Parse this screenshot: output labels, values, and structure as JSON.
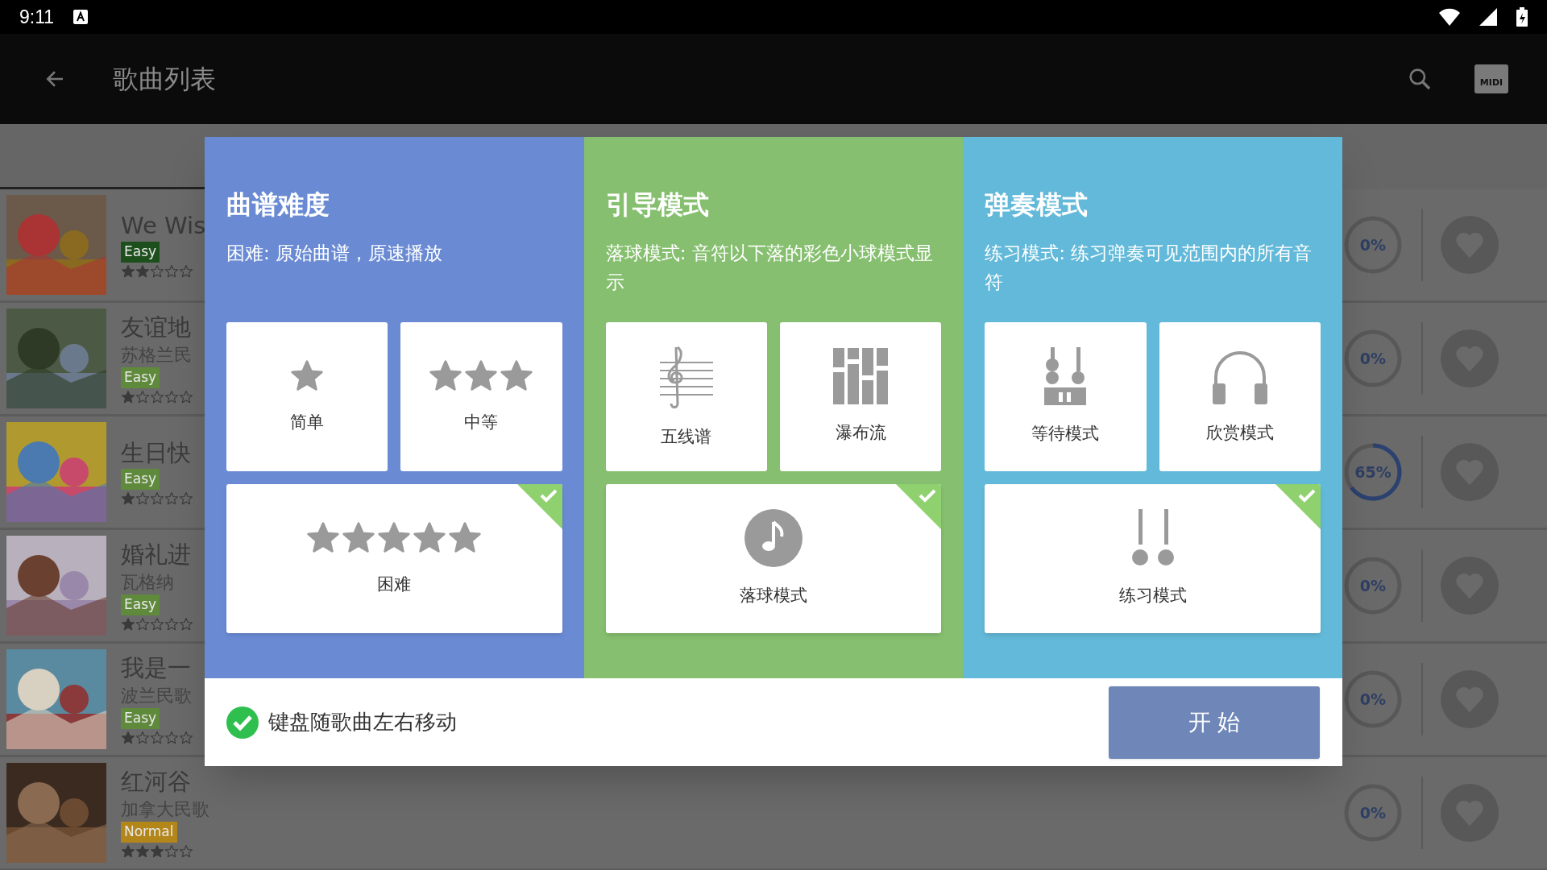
{
  "status_bar": {
    "time": "9:11"
  },
  "app_bar": {
    "title": "歌曲列表",
    "midi_label": "MIDI"
  },
  "songs": [
    {
      "title": "We Wis",
      "badge": "Easy",
      "color": "#1d4f1d",
      "stars": 2,
      "progress": "0%"
    },
    {
      "title": "友谊地",
      "subtitle": "苏格兰民",
      "badge": "Easy",
      "color": "#5f8a3c",
      "stars": 1,
      "progress": "0%"
    },
    {
      "title": "生日快",
      "badge": "Easy",
      "color": "#5f8a3c",
      "stars": 1,
      "progress": "65%"
    },
    {
      "title": "婚礼进",
      "subtitle": "瓦格纳",
      "badge": "Easy",
      "color": "#5f8a3c",
      "stars": 1,
      "progress": "0%"
    },
    {
      "title": "我是一",
      "subtitle": "波兰民歌",
      "badge": "Easy",
      "color": "#5f8a3c",
      "stars": 1,
      "progress": "0%"
    },
    {
      "title": "红河谷",
      "subtitle": "加拿大民歌",
      "badge": "Normal",
      "color": "#b3861a",
      "stars": 3,
      "progress": "0%"
    }
  ],
  "dialog": {
    "sections": [
      {
        "title": "曲谱难度",
        "description": "困难: 原始曲谱，原速播放",
        "color": "#6a8bd4",
        "options": [
          {
            "label": "简单",
            "kind": "star1",
            "selected": false
          },
          {
            "label": "中等",
            "kind": "star3",
            "selected": false
          },
          {
            "label": "困难",
            "kind": "star5",
            "selected": true
          }
        ]
      },
      {
        "title": "引导模式",
        "description": "落球模式: 音符以下落的彩色小球模式显示",
        "color": "#86bf6f",
        "options": [
          {
            "label": "五线谱",
            "kind": "staff",
            "selected": false
          },
          {
            "label": "瀑布流",
            "kind": "waterfall",
            "selected": false
          },
          {
            "label": "落球模式",
            "kind": "ball",
            "selected": true
          }
        ]
      },
      {
        "title": "弹奏模式",
        "description": "练习模式: 练习弹奏可见范围内的所有音符",
        "color": "#63b9d9",
        "options": [
          {
            "label": "等待模式",
            "kind": "wait",
            "selected": false
          },
          {
            "label": "欣赏模式",
            "kind": "headphones",
            "selected": false
          },
          {
            "label": "练习模式",
            "kind": "practice",
            "selected": true
          }
        ]
      }
    ],
    "keyboard_follow": {
      "label": "键盘随歌曲左右移动",
      "checked": true
    },
    "start_button": "开 始"
  }
}
